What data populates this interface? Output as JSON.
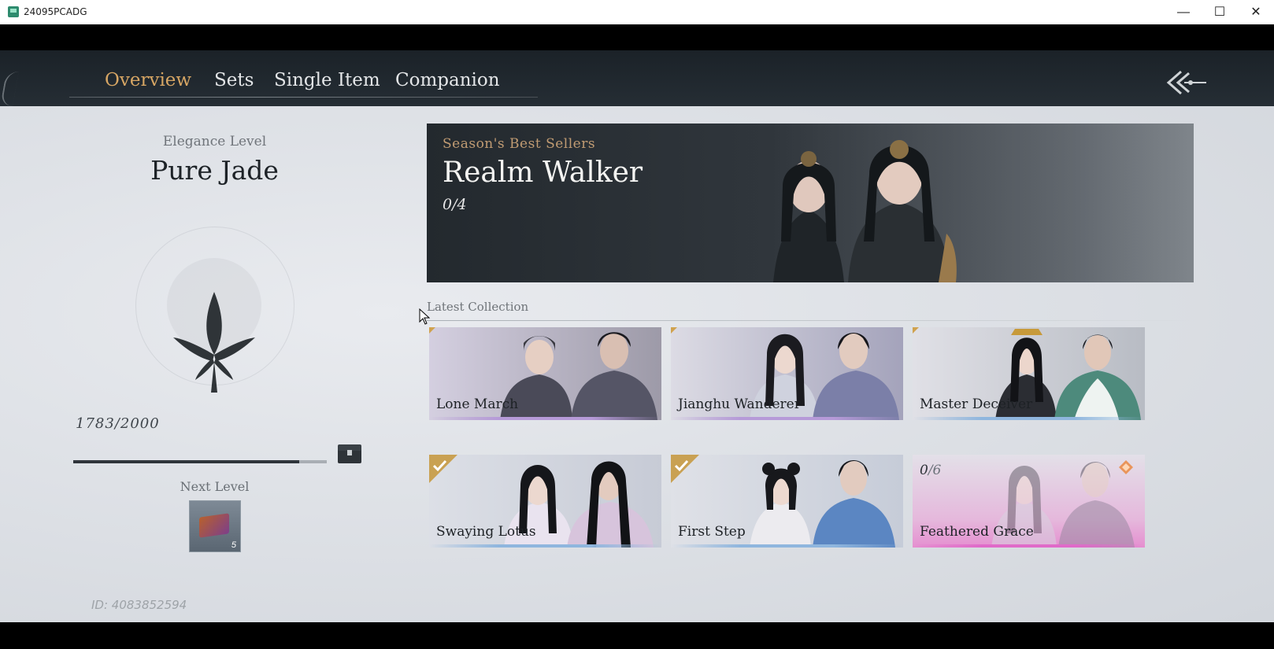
{
  "window": {
    "title": "24095PCADG",
    "minimize": "—",
    "maximize": "☐",
    "close": "✕"
  },
  "tabs": [
    {
      "label": "Overview",
      "active": true
    },
    {
      "label": "Sets",
      "active": false
    },
    {
      "label": "Single Item",
      "active": false
    },
    {
      "label": "Companion",
      "active": false
    }
  ],
  "elegance": {
    "label": "Elegance Level",
    "value": "Pure Jade"
  },
  "progress": {
    "text": "1783/2000",
    "current": 1783,
    "max": 2000
  },
  "next_level": {
    "label": "Next Level",
    "reward_count": "5"
  },
  "player": {
    "id": "ID: 4083852594"
  },
  "banner": {
    "subtitle": "Season's Best Sellers",
    "title": "Realm Walker",
    "count": "0/4"
  },
  "latest": {
    "label": "Latest Collection",
    "cards": [
      {
        "name": "Lone March",
        "bar": "#b69ad8"
      },
      {
        "name": "Jianghu Wanderer",
        "bar": "#b69ad8"
      },
      {
        "name": "Master Deceiver",
        "bar": "#8fb6de"
      },
      {
        "name": "Swaying Lotus",
        "bar": "#8fb6de",
        "owned": true
      },
      {
        "name": "First Step",
        "bar": "#8fb6de",
        "owned": true
      },
      {
        "name": "Feathered Grace",
        "bar": "#e06ac9",
        "count_owned": "0",
        "count_total": "/6"
      }
    ]
  },
  "colors": {
    "accent": "#d7a664",
    "bar_fill": "#2f353b"
  }
}
